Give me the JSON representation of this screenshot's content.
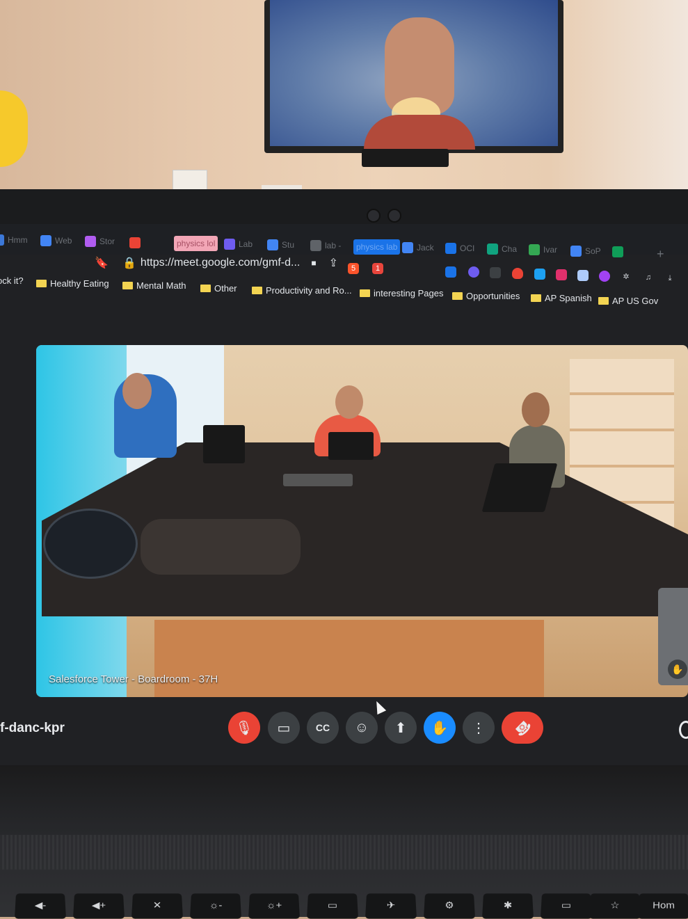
{
  "browser": {
    "tabs": [
      {
        "label": "Hmm",
        "color": "#3c78d8"
      },
      {
        "label": "Web",
        "color": "#4285f4"
      },
      {
        "label": "Stor",
        "color": "#b05cf0"
      },
      {
        "label": "",
        "color": "#ea4335"
      },
      {
        "label": "physics lol",
        "color": "#f2a6b6",
        "highlight": "pink"
      },
      {
        "label": "Lab",
        "color": "#6e5cf0"
      },
      {
        "label": "Stu",
        "color": "#4285f4"
      },
      {
        "label": "lab -",
        "color": "#5f6368"
      },
      {
        "label": "physics lab",
        "color": "#1a73e8",
        "highlight": "blue"
      },
      {
        "label": "Jack",
        "color": "#4285f4"
      },
      {
        "label": "OCI",
        "color": "#1a73e8"
      },
      {
        "label": "Cha",
        "color": "#10a37f"
      },
      {
        "label": "Ivar",
        "color": "#34a853"
      },
      {
        "label": "SoP",
        "color": "#4285f4"
      },
      {
        "label": "",
        "color": "#0f9d58"
      }
    ],
    "new_tab": "+",
    "url": "https://meet.google.com/gmf-d...",
    "bookmarks": [
      {
        "label": "ock it?",
        "folder": false
      },
      {
        "label": "Healthy Eating",
        "folder": true
      },
      {
        "label": "Mental Math",
        "folder": true
      },
      {
        "label": "Other",
        "folder": true
      },
      {
        "label": "Productivity and Ro...",
        "folder": true
      },
      {
        "label": "interesting Pages",
        "folder": true
      },
      {
        "label": "Opportunities",
        "folder": true
      },
      {
        "label": "AP Spanish",
        "folder": true
      },
      {
        "label": "AP US Gov",
        "folder": true
      }
    ],
    "extension_badges": [
      "5",
      "1"
    ]
  },
  "meet": {
    "tile_label": "Salesforce Tower - Boardroom - 37H",
    "meeting_code": "f-danc-kpr",
    "controls": [
      {
        "name": "mic-off",
        "glyph": "🎙"
      },
      {
        "name": "camera",
        "glyph": "▭"
      },
      {
        "name": "captions",
        "glyph": "CC"
      },
      {
        "name": "reactions",
        "glyph": "☺"
      },
      {
        "name": "present",
        "glyph": "⬆"
      },
      {
        "name": "raise-hand",
        "glyph": "✋"
      },
      {
        "name": "more-options",
        "glyph": "⋮"
      },
      {
        "name": "leave-call",
        "glyph": "☎"
      }
    ],
    "hand_badge": "✋"
  },
  "keyboard": {
    "keys": [
      "◀-",
      "◀+",
      "✕",
      "☼-",
      "☼+",
      "▭",
      "✈",
      "⚙",
      "✱",
      "▭",
      "☆",
      "Hom"
    ]
  },
  "colors": {
    "mic_off": "#ea4335",
    "raise_hand": "#1a8cff",
    "leave": "#ea4335",
    "control_bg": "#3c4043"
  }
}
